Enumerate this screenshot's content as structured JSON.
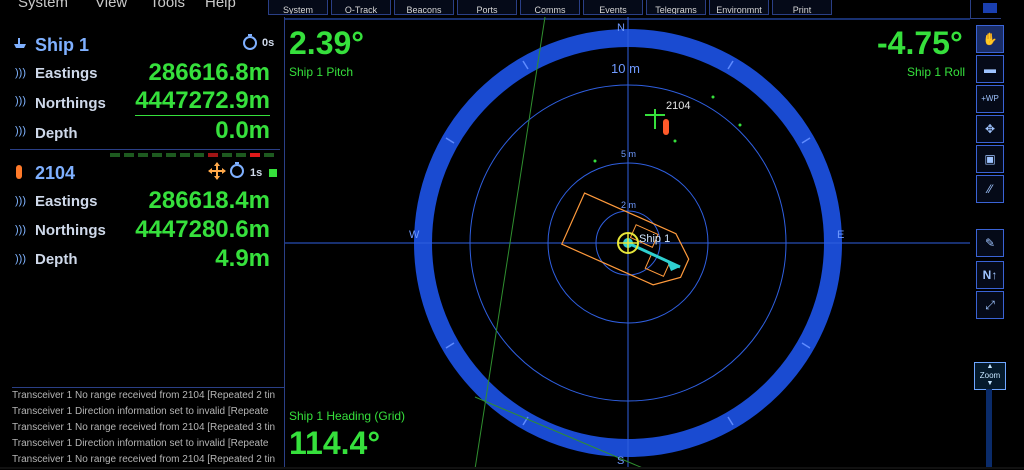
{
  "menu": [
    "System",
    "View",
    "Tools",
    "Help"
  ],
  "toolbar": [
    "System",
    "O-Track",
    "Beacons",
    "Ports",
    "Comms",
    "Events",
    "Telegrams",
    "Environmnt",
    "Print"
  ],
  "ship": {
    "name": "Ship 1",
    "timer": "0s",
    "eastings_label": "Eastings",
    "eastings": "286616.8m",
    "northings_label": "Northings",
    "northings": "4447272.9m",
    "depth_label": "Depth",
    "depth": "0.0m"
  },
  "beacon": {
    "name": "2104",
    "timer": "1s",
    "eastings_label": "Eastings",
    "eastings": "286618.4m",
    "northings_label": "Northings",
    "northings": "4447280.6m",
    "depth_label": "Depth",
    "depth": "4.9m"
  },
  "messages": [
    "Transceiver 1 No range received from 2104  [Repeated 2 tin",
    "Transceiver 1 Direction information set to invalid  [Repeate",
    "Transceiver 1 No range received from 2104  [Repeated 3 tin",
    "Transceiver 1 Direction information set to invalid  [Repeate",
    "Transceiver 1 No range received from 2104  [Repeated 2 tin"
  ],
  "radar": {
    "pitch": "2.39°",
    "pitch_label": "Ship 1 Pitch",
    "roll": "-4.75°",
    "roll_label": "Ship 1 Roll",
    "heading_label": "Ship 1 Heading (Grid)",
    "heading": "114.4°",
    "range_outer": "10 m",
    "range_mid": "5 m",
    "range_inner": "2 m",
    "north": "N",
    "south": "S",
    "east": "E",
    "west": "W",
    "beacon_label": "2104",
    "ship_label": "Ship 1"
  },
  "side_buttons": [
    "select-icon",
    "pan-icon",
    "waypoint-icon",
    "move-icon",
    "zoom-box-icon",
    "measure-icon",
    "edit-icon",
    "north-up-icon",
    "fit-icon"
  ],
  "zoom_label": "Zoom",
  "colors": {
    "accent": "#36e03c",
    "ring": "#1a4bd1",
    "panel_border": "#2a3f86"
  }
}
